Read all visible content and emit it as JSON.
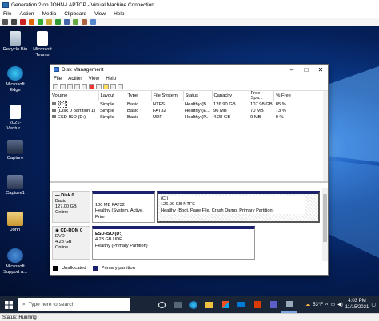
{
  "vm": {
    "title": "Generation 2 on JOHN-LAPTOP - Virtual Machine Connection",
    "menu": [
      "File",
      "Action",
      "Media",
      "Clipboard",
      "View",
      "Help"
    ],
    "status": "Status: Running"
  },
  "desktop": {
    "icons": [
      {
        "label": "Recycle Bin"
      },
      {
        "label": "Microsoft Teams"
      },
      {
        "label": "Microsoft Edge"
      },
      {
        "label": "2021-Ventur..."
      },
      {
        "label": "Capture"
      },
      {
        "label": "Capture1"
      },
      {
        "label": "John"
      },
      {
        "label": "Microsoft Support a..."
      }
    ]
  },
  "dm": {
    "title": "Disk Management",
    "menu": [
      "File",
      "Action",
      "View",
      "Help"
    ],
    "columns": [
      "Volume",
      "Layout",
      "Type",
      "File System",
      "Status",
      "Capacity",
      "Free Spa...",
      "% Free"
    ],
    "rows": [
      [
        "(C:)",
        "Simple",
        "Basic",
        "NTFS",
        "Healthy (B...",
        "126.90 GB",
        "107.98 GB",
        "85 %"
      ],
      [
        "(Disk 0 partition 1)",
        "Simple",
        "Basic",
        "FAT32",
        "Healthy (E...",
        "96 MB",
        "70 MB",
        "73 %"
      ],
      [
        "ESD-ISO (D:)",
        "Simple",
        "Basic",
        "UDF",
        "Healthy (P...",
        "4.28 GB",
        "0 MB",
        "0 %"
      ]
    ],
    "disk0": {
      "name": "Disk 0",
      "type": "Basic",
      "size": "127.00 GB",
      "state": "Online",
      "part1": {
        "size": "100 MB FAT32",
        "status": "Healthy (System, Active, Prim"
      },
      "part2": {
        "name": "(C:)",
        "size": "126.90 GB NTFS",
        "status": "Healthy (Boot, Page File, Crash Dump, Primary Partition)"
      }
    },
    "cdrom0": {
      "name": "CD-ROM 0",
      "type": "DVD",
      "size": "4.28 GB",
      "state": "Online",
      "part": {
        "name": "ESD-ISO (D:)",
        "size": "4.28 GB UDF",
        "status": "Healthy (Primary Partition)"
      }
    },
    "legend": {
      "unallocated": "Unallocated",
      "primary": "Primary partition"
    }
  },
  "taskbar": {
    "search_placeholder": "Type here to search",
    "weather": "53°F",
    "time": "4:03 PM",
    "date": "11/15/2021"
  },
  "colors": {
    "primary_partition": "#1a1f6e",
    "unallocated": "#000000"
  }
}
